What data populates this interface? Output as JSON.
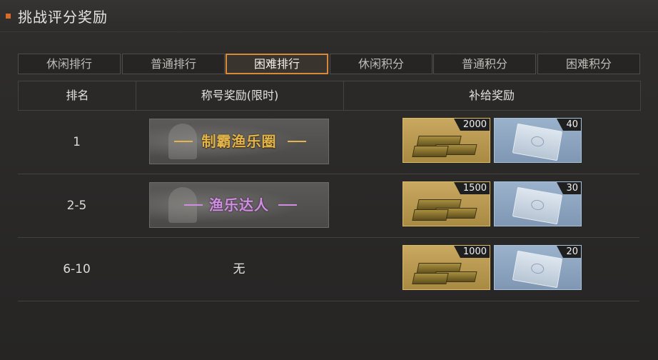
{
  "header": {
    "title": "挑战评分奖励"
  },
  "tabs": [
    {
      "label": "休闲排行",
      "active": false
    },
    {
      "label": "普通排行",
      "active": false
    },
    {
      "label": "困难排行",
      "active": true
    },
    {
      "label": "休闲积分",
      "active": false
    },
    {
      "label": "普通积分",
      "active": false
    },
    {
      "label": "困难积分",
      "active": false
    }
  ],
  "table": {
    "headers": [
      "排名",
      "称号奖励(限时)",
      "补给奖励"
    ],
    "rows": [
      {
        "rank": "1",
        "title": "制霸渔乐圈",
        "title_style": "gold",
        "gold_count": "2000",
        "ticket_count": "40"
      },
      {
        "rank": "2-5",
        "title": "渔乐达人",
        "title_style": "purple",
        "gold_count": "1500",
        "ticket_count": "30"
      },
      {
        "rank": "6-10",
        "title": "无",
        "title_style": "none",
        "gold_count": "1000",
        "ticket_count": "20"
      }
    ]
  },
  "icons": {
    "gold_item": "gold-bars-icon",
    "ticket_item": "supply-pack-icon"
  },
  "colors": {
    "accent": "#d88a3a",
    "header_mark": "#d86a2a",
    "gold_title": "#e2b64c",
    "purple_title": "#cf8fe0"
  }
}
